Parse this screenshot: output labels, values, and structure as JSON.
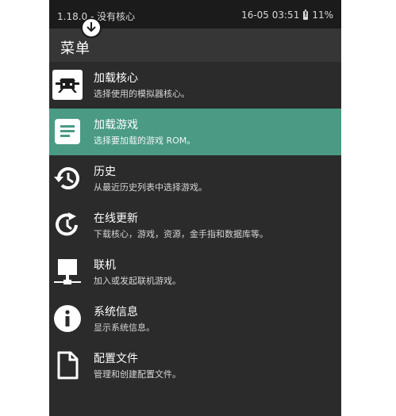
{
  "status_bar": {
    "left_text": "1.18.0 - 没有核心",
    "right_time": "16-05 03:51",
    "battery": "11%"
  },
  "app_bar": {
    "title": "菜单"
  },
  "colors": {
    "accent": "#4a9a84",
    "background": "#2b2b2b",
    "appbar": "#363636"
  },
  "menu_items": [
    {
      "title": "加载核心",
      "subtitle": "选择使用的模拟器核心。",
      "icon": "core-icon"
    },
    {
      "title": "加载游戏",
      "subtitle": "选择要加载的游戏 ROM。",
      "icon": "document-icon",
      "selected": true
    },
    {
      "title": "历史",
      "subtitle": "从最近历史列表中选择游戏。",
      "icon": "history-icon"
    },
    {
      "title": "在线更新",
      "subtitle": "下载核心，游戏，资源，金手指和数据库等。",
      "icon": "update-icon"
    },
    {
      "title": "联机",
      "subtitle": "加入或发起联机游戏。",
      "icon": "network-icon"
    },
    {
      "title": "系统信息",
      "subtitle": "显示系统信息。",
      "icon": "info-icon"
    },
    {
      "title": "配置文件",
      "subtitle": "管理和创建配置文件。",
      "icon": "file-icon"
    }
  ]
}
